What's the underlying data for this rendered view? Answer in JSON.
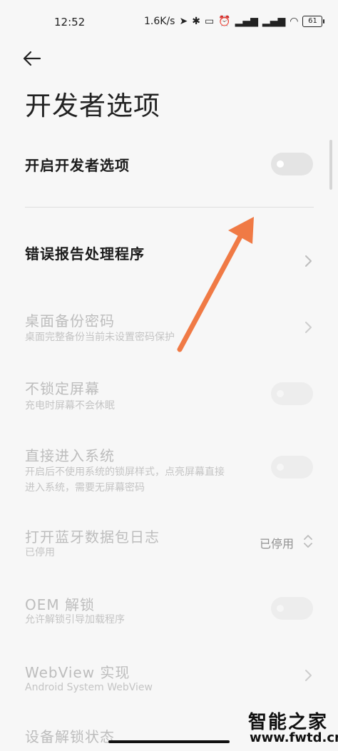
{
  "status_bar": {
    "time": "12:52",
    "network_speed": "1.6K/s",
    "icons": [
      "location-icon",
      "bluetooth-icon",
      "vibrate-icon",
      "alarm-icon",
      "signal-hd-icon",
      "signal-hd-icon",
      "wifi-icon"
    ],
    "battery": "61"
  },
  "header": {
    "back_icon": "back-arrow-icon",
    "title": "开发者选项"
  },
  "settings": [
    {
      "title": "开启开发者选项",
      "control": "toggle",
      "enabled": true,
      "on": false
    },
    {
      "title": "错误报告处理程序",
      "control": "chevron",
      "enabled": true
    },
    {
      "title": "桌面备份密码",
      "subtitle": "桌面完整备份当前未设置密码保护",
      "control": "chevron",
      "enabled": false
    },
    {
      "title": "不锁定屏幕",
      "subtitle": "充电时屏幕不会休眠",
      "control": "toggle",
      "enabled": false,
      "on": false
    },
    {
      "title": "直接进入系统",
      "subtitle_lines": [
        "开启后不使用系统的锁屏样式，点亮屏幕直接",
        "进入系统，需要无屏幕密码"
      ],
      "control": "toggle",
      "enabled": false,
      "on": false
    },
    {
      "title": "打开蓝牙数据包日志",
      "subtitle": "已停用",
      "control": "select",
      "value": "已停用",
      "enabled": false
    },
    {
      "title": "OEM 解锁",
      "subtitle": "允许解锁引导加载程序",
      "control": "toggle",
      "enabled": false,
      "on": false
    },
    {
      "title": "WebView 实现",
      "subtitle": "Android System WebView",
      "control": "chevron",
      "enabled": false
    },
    {
      "title": "设备解锁状态",
      "control": "none",
      "enabled": false
    }
  ],
  "watermark": {
    "text": "智能之家",
    "url": "www.fwtd.cn"
  },
  "colors": {
    "annotation_arrow": "#f07a45",
    "background": "#f7f7f7"
  }
}
